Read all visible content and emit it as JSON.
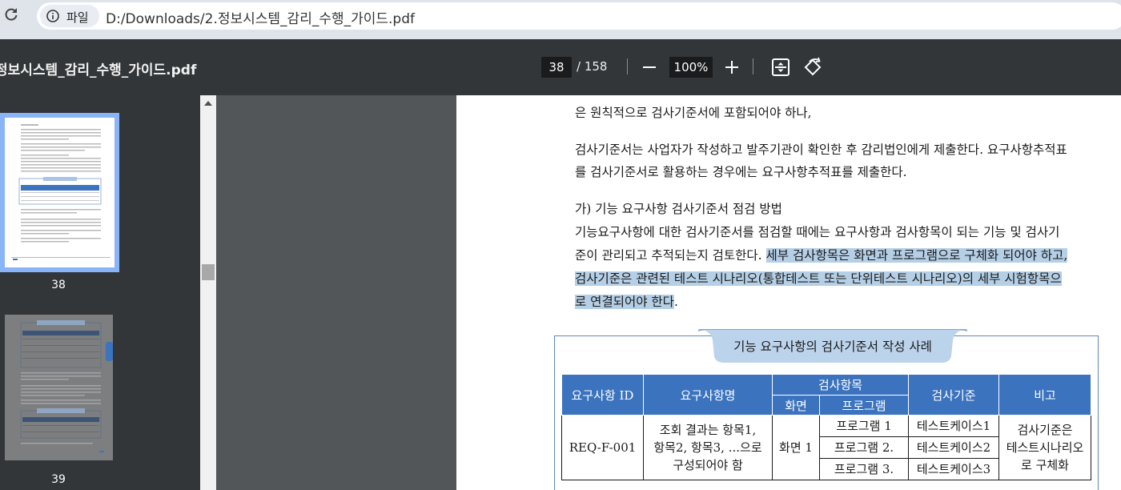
{
  "browser": {
    "chip_label": "파일",
    "url": "D:/Downloads/2.정보시스템_감리_수행_가이드.pdf",
    "icons": [
      "reload-icon",
      "info-icon"
    ]
  },
  "toolbar": {
    "title": "정보시스템_감리_수행_가이드.pdf",
    "page_current": "38",
    "page_total": "/ 158",
    "zoom": "100%",
    "icons": [
      "zoom-out-icon",
      "zoom-in-icon",
      "fit-page-icon",
      "rotate-icon"
    ]
  },
  "sidebar": {
    "thumbnails": [
      {
        "label": "38",
        "selected": true
      },
      {
        "label": "39",
        "selected": false
      }
    ]
  },
  "page": {
    "line1": "은 원칙적으로 검사기준서에 포함되어야 하나,",
    "para2_line1": "검사기준서는 사업자가 작성하고 발주기관이 확인한 후 감리법인에게 제출한다. 요구사항추적표",
    "para2_line2": "를 검사기준서로 활용하는 경우에는 요구사항추적표를 제출한다.",
    "heading": "가) 기능 요구사항 검사기준서 점검 방법",
    "para3_line1": "기능요구사항에 대한 검사기준서를 점검할 때에는 요구사항과 검사항목이 되는 기능 및 검사기",
    "para3_line2_plain": "준이 관리되고 추적되는지 검토한다. ",
    "para3_line2_highlight": "세부 검사항목은 화면과 프로그램으로 구체화 되어야 하고,",
    "para3_line3_highlight": "검사기준은 관련된 테스트 시나리오(통합테스트 또는 단위테스트 시나리오)의 세부 시험항목으",
    "para3_line4_highlight": "로 연결되어야 한다",
    "para3_line4_end": ".",
    "highlight_color": "#b4cfe6"
  },
  "sample": {
    "caption": "기능 요구사항의 검사기준서 작성 사례",
    "headers": {
      "req_id": "요구사항 ID",
      "req_name": "요구사항명",
      "check_items": "검사항목",
      "screen": "화면",
      "program": "프로그램",
      "criteria": "검사기준",
      "remarks": "비고"
    },
    "row": {
      "req_id": "REQ-F-001",
      "req_name_lines": [
        "조회 결과는 항목1,",
        "항목2, 항목3, ...으로",
        "구성되어야 함"
      ],
      "screen": "화면 1",
      "programs": [
        "프로그램 1",
        "프로그램 2.",
        "프로그램 3."
      ],
      "criteria": [
        "테스트케이스1",
        "테스트케이스2",
        "테스트케이스3"
      ],
      "remarks_lines": [
        "검사기준은",
        "테스트시나리오",
        "로 구체화"
      ]
    },
    "header_color": "#3b73be"
  }
}
